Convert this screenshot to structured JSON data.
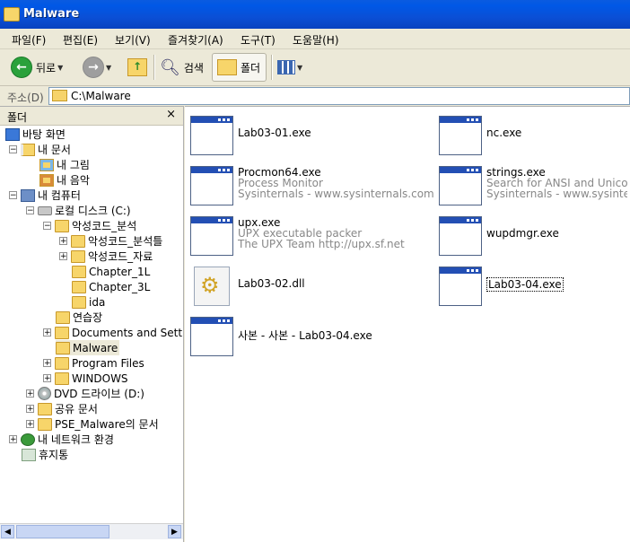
{
  "window": {
    "title": "Malware"
  },
  "menu": [
    "파일(F)",
    "편집(E)",
    "보기(V)",
    "즐겨찾기(A)",
    "도구(T)",
    "도움말(H)"
  ],
  "toolbar": {
    "back_label": "뒤로",
    "search_label": "검색",
    "folders_label": "폴더"
  },
  "address": {
    "label": "주소(D)",
    "path": "C:\\Malware"
  },
  "tree": {
    "header": "폴더",
    "close": "×",
    "items": [
      {
        "label": "바탕 화면",
        "icon": "desktop-icon"
      },
      {
        "label": "내 문서",
        "icon": "my-documents-icon"
      },
      {
        "label": "내 그림",
        "icon": "my-pictures-icon"
      },
      {
        "label": "내 음악",
        "icon": "my-music-icon"
      },
      {
        "label": "내 컴퓨터",
        "icon": "my-computer-icon"
      },
      {
        "label": "로컬 디스크 (C:)",
        "icon": "local-disk-icon"
      },
      {
        "label": "악성코드_분석",
        "icon": "folder-icon"
      },
      {
        "label": "악성코드_분석틀",
        "icon": "folder-icon"
      },
      {
        "label": "악성코드_자료",
        "icon": "folder-icon"
      },
      {
        "label": "Chapter_1L",
        "icon": "folder-icon"
      },
      {
        "label": "Chapter_3L",
        "icon": "folder-icon"
      },
      {
        "label": "ida",
        "icon": "folder-icon"
      },
      {
        "label": "연습장",
        "icon": "folder-icon"
      },
      {
        "label": "Documents and Setti",
        "icon": "folder-icon"
      },
      {
        "label": "Malware",
        "icon": "folder-icon"
      },
      {
        "label": "Program Files",
        "icon": "folder-icon"
      },
      {
        "label": "WINDOWS",
        "icon": "folder-icon"
      },
      {
        "label": "DVD 드라이브 (D:)",
        "icon": "dvd-drive-icon"
      },
      {
        "label": "공유 문서",
        "icon": "folder-icon"
      },
      {
        "label": "PSE_Malware의 문서",
        "icon": "folder-icon"
      },
      {
        "label": "내 네트워크 환경",
        "icon": "network-icon"
      },
      {
        "label": "휴지통",
        "icon": "recycle-bin-icon"
      }
    ]
  },
  "files": [
    {
      "name": "Lab03-01.exe",
      "desc1": "",
      "desc2": "",
      "type": "exe"
    },
    {
      "name": "nc.exe",
      "desc1": "",
      "desc2": "",
      "type": "exe"
    },
    {
      "name": "Procmon64.exe",
      "desc1": "Process Monitor",
      "desc2": "Sysinternals - www.sysinternals.com",
      "type": "exe"
    },
    {
      "name": "strings.exe",
      "desc1": "Search for ANSI and Unicod",
      "desc2": "Sysinternals - www.sysinte",
      "type": "exe"
    },
    {
      "name": "upx.exe",
      "desc1": "UPX executable packer",
      "desc2": "The UPX Team http://upx.sf.net",
      "type": "exe"
    },
    {
      "name": "wupdmgr.exe",
      "desc1": "",
      "desc2": "",
      "type": "exe"
    },
    {
      "name": "Lab03-02.dll",
      "desc1": "",
      "desc2": "",
      "type": "dll"
    },
    {
      "name": "Lab03-04.exe",
      "desc1": "",
      "desc2": "",
      "type": "exe"
    },
    {
      "name": "사본 - 사본 - Lab03-04.exe",
      "desc1": "",
      "desc2": "",
      "type": "exe"
    }
  ]
}
